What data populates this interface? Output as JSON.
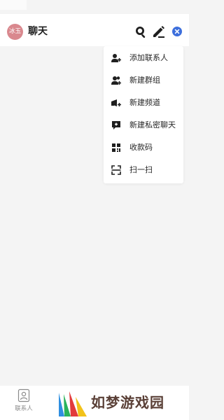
{
  "header": {
    "avatar_text": "冰玉",
    "title": "聊天",
    "icons": [
      "search-icon",
      "edit-icon",
      "close-icon"
    ]
  },
  "menu": {
    "items": [
      {
        "label": "添加联系人",
        "icon": "add-contact-icon"
      },
      {
        "label": "新建群组",
        "icon": "new-group-icon"
      },
      {
        "label": "新建频道",
        "icon": "new-channel-icon"
      },
      {
        "label": "新建私密聊天",
        "icon": "private-chat-icon"
      },
      {
        "label": "收款码",
        "icon": "payment-code-icon"
      },
      {
        "label": "扫一扫",
        "icon": "scan-icon"
      }
    ]
  },
  "bottom_nav": {
    "contacts_label": "联系人"
  },
  "watermark": {
    "text": "如梦游戏园"
  },
  "colors": {
    "background": "#f4f4f4",
    "avatar": "#d9888e",
    "close_button": "#3d6fdc"
  }
}
